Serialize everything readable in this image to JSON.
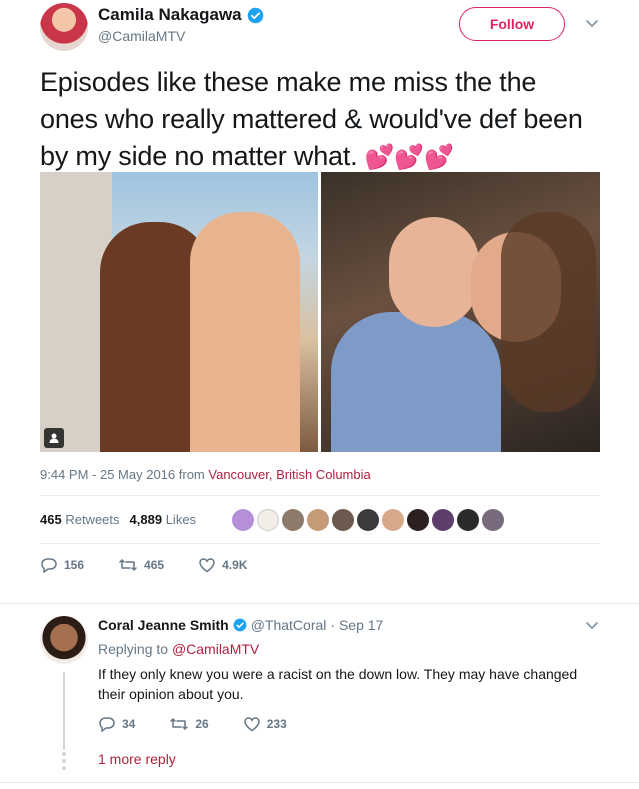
{
  "tweet": {
    "author_name": "Camila Nakagawa",
    "author_handle": "@CamilaMTV",
    "follow_label": "Follow",
    "text": "Episodes like these make me miss the the ones who really mattered & would've def been by my side no matter what.",
    "emoji": "💕💕💕",
    "timestamp": "9:44 PM - 25 May 2016",
    "from_label": "from",
    "location": "Vancouver, British Columbia",
    "retweets_count": "465",
    "retweets_label": "Retweets",
    "likes_count": "4,889",
    "likes_label": "Likes",
    "actions": {
      "reply_count": "156",
      "retweet_count": "465",
      "like_count": "4.9K"
    }
  },
  "reply": {
    "author_name": "Coral Jeanne Smith",
    "author_handle": "@ThatCoral",
    "date": "· Sep 17",
    "replying_to_prefix": "Replying to",
    "replying_to_handle": "@CamilaMTV",
    "text": "If they only knew you were a racist on the down low. They may have changed their opinion about you.",
    "actions": {
      "reply_count": "34",
      "retweet_count": "26",
      "like_count": "233"
    },
    "more_replies": "1 more reply"
  },
  "colors": {
    "accent": "#e0245e",
    "link": "#b0213f",
    "verified": "#1da1f2",
    "muted": "#657786"
  }
}
